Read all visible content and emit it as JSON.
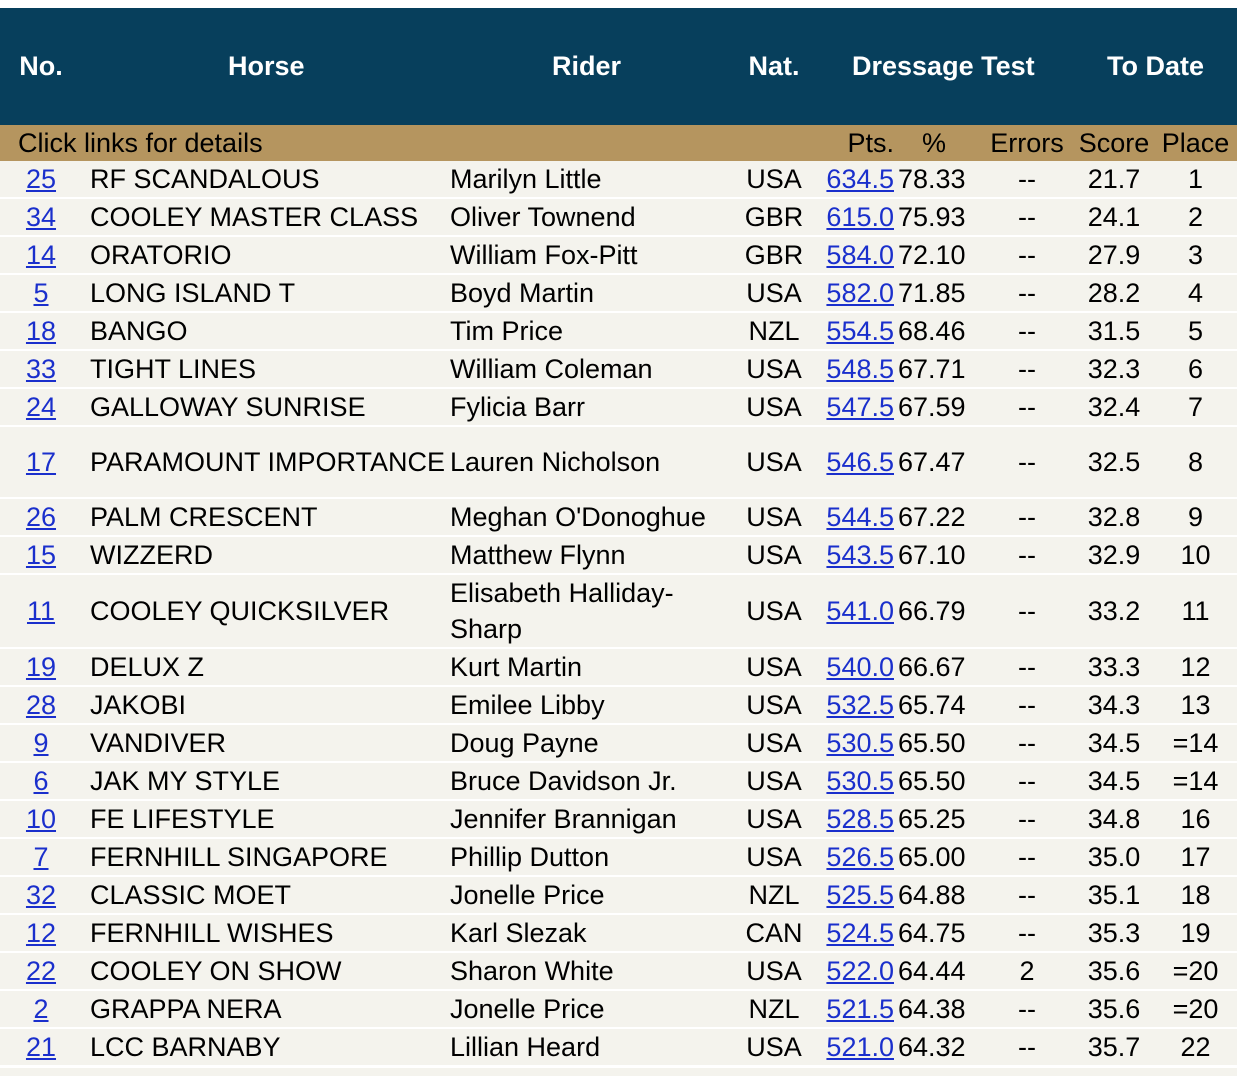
{
  "header": {
    "no": "No.",
    "horse": "Horse",
    "rider": "Rider",
    "nat": "Nat.",
    "dressage_test": "Dressage Test",
    "to_date": "To Date"
  },
  "subheader": {
    "click_links": "Click links for details",
    "pts": "Pts.",
    "pct": "%",
    "errors": "Errors",
    "score": "Score",
    "place": "Place"
  },
  "rows": [
    {
      "no": "25",
      "horse": "RF SCANDALOUS",
      "rider": "Marilyn Little",
      "nat": "USA",
      "pts": "634.5",
      "pct": "78.33",
      "errors": "--",
      "score": "21.7",
      "place": "1"
    },
    {
      "no": "34",
      "horse": "COOLEY MASTER CLASS",
      "rider": "Oliver Townend",
      "nat": "GBR",
      "pts": "615.0",
      "pct": "75.93",
      "errors": "--",
      "score": "24.1",
      "place": "2"
    },
    {
      "no": "14",
      "horse": "ORATORIO",
      "rider": "William Fox-Pitt",
      "nat": "GBR",
      "pts": "584.0",
      "pct": "72.10",
      "errors": "--",
      "score": "27.9",
      "place": "3"
    },
    {
      "no": "5",
      "horse": "LONG ISLAND T",
      "rider": "Boyd Martin",
      "nat": "USA",
      "pts": "582.0",
      "pct": "71.85",
      "errors": "--",
      "score": "28.2",
      "place": "4"
    },
    {
      "no": "18",
      "horse": "BANGO",
      "rider": "Tim Price",
      "nat": "NZL",
      "pts": "554.5",
      "pct": "68.46",
      "errors": "--",
      "score": "31.5",
      "place": "5"
    },
    {
      "no": "33",
      "horse": "TIGHT LINES",
      "rider": "William Coleman",
      "nat": "USA",
      "pts": "548.5",
      "pct": "67.71",
      "errors": "--",
      "score": "32.3",
      "place": "6"
    },
    {
      "no": "24",
      "horse": "GALLOWAY SUNRISE",
      "rider": "Fylicia Barr",
      "nat": "USA",
      "pts": "547.5",
      "pct": "67.59",
      "errors": "--",
      "score": "32.4",
      "place": "7"
    },
    {
      "no": "17",
      "horse": "PARAMOUNT IMPORTANCE",
      "rider": "Lauren Nicholson",
      "nat": "USA",
      "pts": "546.5",
      "pct": "67.47",
      "errors": "--",
      "score": "32.5",
      "place": "8"
    },
    {
      "no": "26",
      "horse": "PALM CRESCENT",
      "rider": "Meghan O'Donoghue",
      "nat": "USA",
      "pts": "544.5",
      "pct": "67.22",
      "errors": "--",
      "score": "32.8",
      "place": "9"
    },
    {
      "no": "15",
      "horse": "WIZZERD",
      "rider": "Matthew Flynn",
      "nat": "USA",
      "pts": "543.5",
      "pct": "67.10",
      "errors": "--",
      "score": "32.9",
      "place": "10"
    },
    {
      "no": "11",
      "horse": "COOLEY QUICKSILVER",
      "rider": "Elisabeth Halliday-Sharp",
      "nat": "USA",
      "pts": "541.0",
      "pct": "66.79",
      "errors": "--",
      "score": "33.2",
      "place": "11"
    },
    {
      "no": "19",
      "horse": "DELUX Z",
      "rider": "Kurt Martin",
      "nat": "USA",
      "pts": "540.0",
      "pct": "66.67",
      "errors": "--",
      "score": "33.3",
      "place": "12"
    },
    {
      "no": "28",
      "horse": "JAKOBI",
      "rider": "Emilee Libby",
      "nat": "USA",
      "pts": "532.5",
      "pct": "65.74",
      "errors": "--",
      "score": "34.3",
      "place": "13"
    },
    {
      "no": "9",
      "horse": "VANDIVER",
      "rider": "Doug Payne",
      "nat": "USA",
      "pts": "530.5",
      "pct": "65.50",
      "errors": "--",
      "score": "34.5",
      "place": "=14"
    },
    {
      "no": "6",
      "horse": "JAK MY STYLE",
      "rider": "Bruce Davidson Jr.",
      "nat": "USA",
      "pts": "530.5",
      "pct": "65.50",
      "errors": "--",
      "score": "34.5",
      "place": "=14"
    },
    {
      "no": "10",
      "horse": "FE LIFESTYLE",
      "rider": "Jennifer Brannigan",
      "nat": "USA",
      "pts": "528.5",
      "pct": "65.25",
      "errors": "--",
      "score": "34.8",
      "place": "16"
    },
    {
      "no": "7",
      "horse": "FERNHILL SINGAPORE",
      "rider": "Phillip Dutton",
      "nat": "USA",
      "pts": "526.5",
      "pct": "65.00",
      "errors": "--",
      "score": "35.0",
      "place": "17"
    },
    {
      "no": "32",
      "horse": "CLASSIC MOET",
      "rider": "Jonelle Price",
      "nat": "NZL",
      "pts": "525.5",
      "pct": "64.88",
      "errors": "--",
      "score": "35.1",
      "place": "18"
    },
    {
      "no": "12",
      "horse": "FERNHILL WISHES",
      "rider": "Karl Slezak",
      "nat": "CAN",
      "pts": "524.5",
      "pct": "64.75",
      "errors": "--",
      "score": "35.3",
      "place": "19"
    },
    {
      "no": "22",
      "horse": "COOLEY ON SHOW",
      "rider": "Sharon White",
      "nat": "USA",
      "pts": "522.0",
      "pct": "64.44",
      "errors": "2",
      "score": "35.6",
      "place": "=20"
    },
    {
      "no": "2",
      "horse": "GRAPPA NERA",
      "rider": "Jonelle Price",
      "nat": "NZL",
      "pts": "521.5",
      "pct": "64.38",
      "errors": "--",
      "score": "35.6",
      "place": "=20"
    },
    {
      "no": "21",
      "horse": "LCC BARNABY",
      "rider": "Lillian Heard",
      "nat": "USA",
      "pts": "521.0",
      "pct": "64.32",
      "errors": "--",
      "score": "35.7",
      "place": "22"
    }
  ],
  "colors": {
    "header_bg": "#073f5c",
    "subheader_bg": "#b5955f",
    "row_bg": "#f4f3ed",
    "link": "#1a2fcc"
  }
}
